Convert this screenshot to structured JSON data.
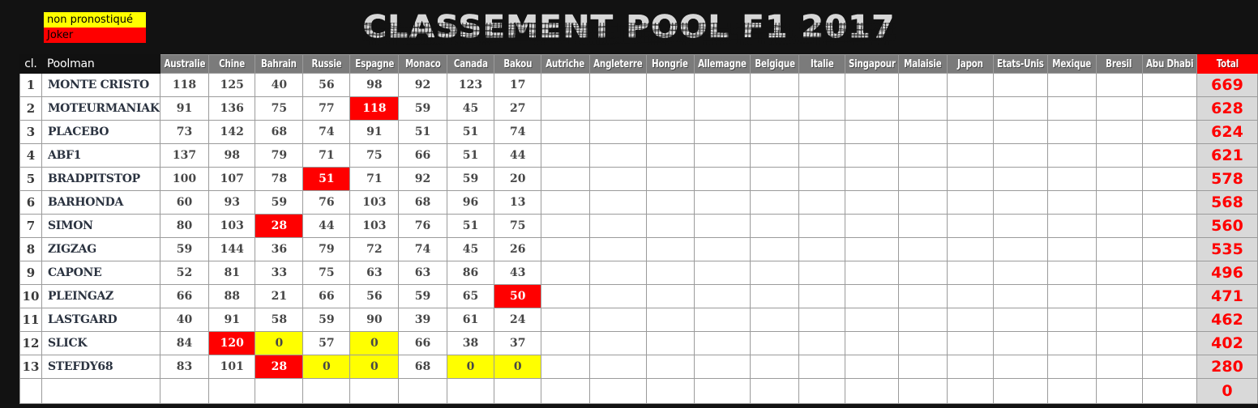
{
  "title": "CLASSEMENT POOL F1 2017",
  "legend": [
    {
      "label": "non pronostiqué",
      "color": "#FFFF00",
      "key": "nonpro"
    },
    {
      "label": "Joker",
      "color": "#FF0000",
      "key": "joker"
    }
  ],
  "table": {
    "headers": [
      "cl.",
      "Poolman",
      "Australie",
      "Chine",
      "Bahrain",
      "Russie",
      "Espagne",
      "Monaco",
      "Canada",
      "Bakou",
      "Autriche",
      "Angleterre",
      "Hongrie",
      "Allemagne",
      "Belgique",
      "Italie",
      "Singapour",
      "Malaisie",
      "Japon",
      "Etats-Unis",
      "Mexique",
      "Bresil",
      "Abu Dhabi",
      "Total"
    ],
    "rows": [
      {
        "rank": "1",
        "name": "MONTE CRISTO",
        "scores": [
          "118",
          "125",
          "40",
          "56",
          "98",
          "92",
          "123",
          "17"
        ],
        "flags": [
          "",
          "",
          "",
          "",
          "",
          "",
          "",
          ""
        ],
        "total": "669"
      },
      {
        "rank": "2",
        "name": "MOTEURMANIAK",
        "scores": [
          "91",
          "136",
          "75",
          "77",
          "118",
          "59",
          "45",
          "27"
        ],
        "flags": [
          "",
          "",
          "",
          "",
          "joker",
          "",
          "",
          ""
        ],
        "total": "628"
      },
      {
        "rank": "3",
        "name": "PLACEBO",
        "scores": [
          "73",
          "142",
          "68",
          "74",
          "91",
          "51",
          "51",
          "74"
        ],
        "flags": [
          "",
          "",
          "",
          "",
          "",
          "",
          "",
          ""
        ],
        "total": "624"
      },
      {
        "rank": "4",
        "name": "ABF1",
        "scores": [
          "137",
          "98",
          "79",
          "71",
          "75",
          "66",
          "51",
          "44"
        ],
        "flags": [
          "",
          "",
          "",
          "",
          "",
          "",
          "",
          ""
        ],
        "total": "621"
      },
      {
        "rank": "5",
        "name": "BRADPITSTOP",
        "scores": [
          "100",
          "107",
          "78",
          "51",
          "71",
          "92",
          "59",
          "20"
        ],
        "flags": [
          "",
          "",
          "",
          "joker",
          "",
          "",
          "",
          ""
        ],
        "total": "578"
      },
      {
        "rank": "6",
        "name": "BARHONDA",
        "scores": [
          "60",
          "93",
          "59",
          "76",
          "103",
          "68",
          "96",
          "13"
        ],
        "flags": [
          "",
          "",
          "",
          "",
          "",
          "",
          "",
          ""
        ],
        "total": "568"
      },
      {
        "rank": "7",
        "name": "SIMON",
        "scores": [
          "80",
          "103",
          "28",
          "44",
          "103",
          "76",
          "51",
          "75"
        ],
        "flags": [
          "",
          "",
          "joker",
          "",
          "",
          "",
          "",
          ""
        ],
        "total": "560"
      },
      {
        "rank": "8",
        "name": "ZIGZAG",
        "scores": [
          "59",
          "144",
          "36",
          "79",
          "72",
          "74",
          "45",
          "26"
        ],
        "flags": [
          "",
          "",
          "",
          "",
          "",
          "",
          "",
          ""
        ],
        "total": "535"
      },
      {
        "rank": "9",
        "name": "CAPONE",
        "scores": [
          "52",
          "81",
          "33",
          "75",
          "63",
          "63",
          "86",
          "43"
        ],
        "flags": [
          "",
          "",
          "",
          "",
          "",
          "",
          "",
          ""
        ],
        "total": "496"
      },
      {
        "rank": "10",
        "name": "PLEINGAZ",
        "scores": [
          "66",
          "88",
          "21",
          "66",
          "56",
          "59",
          "65",
          "50"
        ],
        "flags": [
          "",
          "",
          "",
          "",
          "",
          "",
          "",
          "joker"
        ],
        "total": "471"
      },
      {
        "rank": "11",
        "name": "LASTGARD",
        "scores": [
          "40",
          "91",
          "58",
          "59",
          "90",
          "39",
          "61",
          "24"
        ],
        "flags": [
          "",
          "",
          "",
          "",
          "",
          "",
          "",
          ""
        ],
        "total": "462"
      },
      {
        "rank": "12",
        "name": "SLICK",
        "scores": [
          "84",
          "120",
          "0",
          "57",
          "0",
          "66",
          "38",
          "37"
        ],
        "flags": [
          "",
          "joker",
          "nonpro",
          "",
          "nonpro",
          "",
          "",
          ""
        ],
        "total": "402"
      },
      {
        "rank": "13",
        "name": "STEFDY68",
        "scores": [
          "83",
          "101",
          "28",
          "0",
          "0",
          "68",
          "0",
          "0"
        ],
        "flags": [
          "",
          "",
          "joker",
          "nonpro",
          "nonpro",
          "",
          "nonpro",
          "nonpro"
        ],
        "total": "280"
      },
      {
        "rank": "",
        "name": "",
        "scores": [
          "",
          "",
          "",
          "",
          "",
          "",
          "",
          ""
        ],
        "flags": [
          "",
          "",
          "",
          "",
          "",
          "",
          "",
          ""
        ],
        "total": "0"
      }
    ],
    "filled_race_count": 8,
    "empty_race_count": 14
  },
  "colors": {
    "page_bg": "#121212",
    "header_bg": "#7b7b7b",
    "header_dark_bg": "#111111",
    "total_header_bg": "#FF0000",
    "total_cell_bg": "#d9d9d9",
    "total_text": "#FF0000",
    "joker": "#FF0000",
    "nonpro": "#FFFF00",
    "grid_line": "#9b9b9b",
    "title_text": "#d7d7d7"
  }
}
